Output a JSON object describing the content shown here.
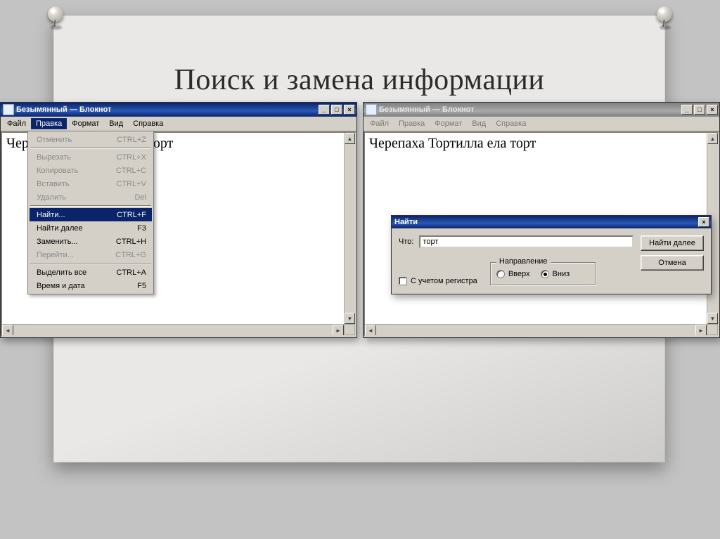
{
  "slide": {
    "title": "Поиск и замена информации"
  },
  "left": {
    "title": "Безымянный — Блокнот",
    "menus": [
      "Файл",
      "Правка",
      "Формат",
      "Вид",
      "Справка"
    ],
    "editorText": "Черепаха Тортилла ела торт",
    "dropdown": {
      "items": [
        {
          "label": "Отменить",
          "shortcut": "CTRL+Z",
          "state": "disabled"
        },
        {
          "sep": true
        },
        {
          "label": "Вырезать",
          "shortcut": "CTRL+X",
          "state": "disabled"
        },
        {
          "label": "Копировать",
          "shortcut": "CTRL+C",
          "state": "disabled"
        },
        {
          "label": "Вставить",
          "shortcut": "CTRL+V",
          "state": "disabled"
        },
        {
          "label": "Удалить",
          "shortcut": "Del",
          "state": "disabled"
        },
        {
          "sep": true
        },
        {
          "label": "Найти...",
          "shortcut": "CTRL+F",
          "state": "highlight"
        },
        {
          "label": "Найти далее",
          "shortcut": "F3",
          "state": "normal"
        },
        {
          "label": "Заменить...",
          "shortcut": "CTRL+H",
          "state": "normal"
        },
        {
          "label": "Перейти...",
          "shortcut": "CTRL+G",
          "state": "disabled"
        },
        {
          "sep": true
        },
        {
          "label": "Выделить все",
          "shortcut": "CTRL+A",
          "state": "normal"
        },
        {
          "label": "Время и дата",
          "shortcut": "F5",
          "state": "normal"
        }
      ]
    }
  },
  "right": {
    "title": "Безымянный — Блокнот",
    "menus": [
      "Файл",
      "Правка",
      "Формат",
      "Вид",
      "Справка"
    ],
    "editorText": "Черепаха Тортилла ела торт"
  },
  "findDialog": {
    "title": "Найти",
    "whatLabel": "Что:",
    "whatValue": "торт",
    "findNext": "Найти далее",
    "cancel": "Отмена",
    "caseLabel": "С учетом регистра",
    "direction": {
      "legend": "Направление",
      "up": "Вверх",
      "down": "Вниз"
    }
  }
}
